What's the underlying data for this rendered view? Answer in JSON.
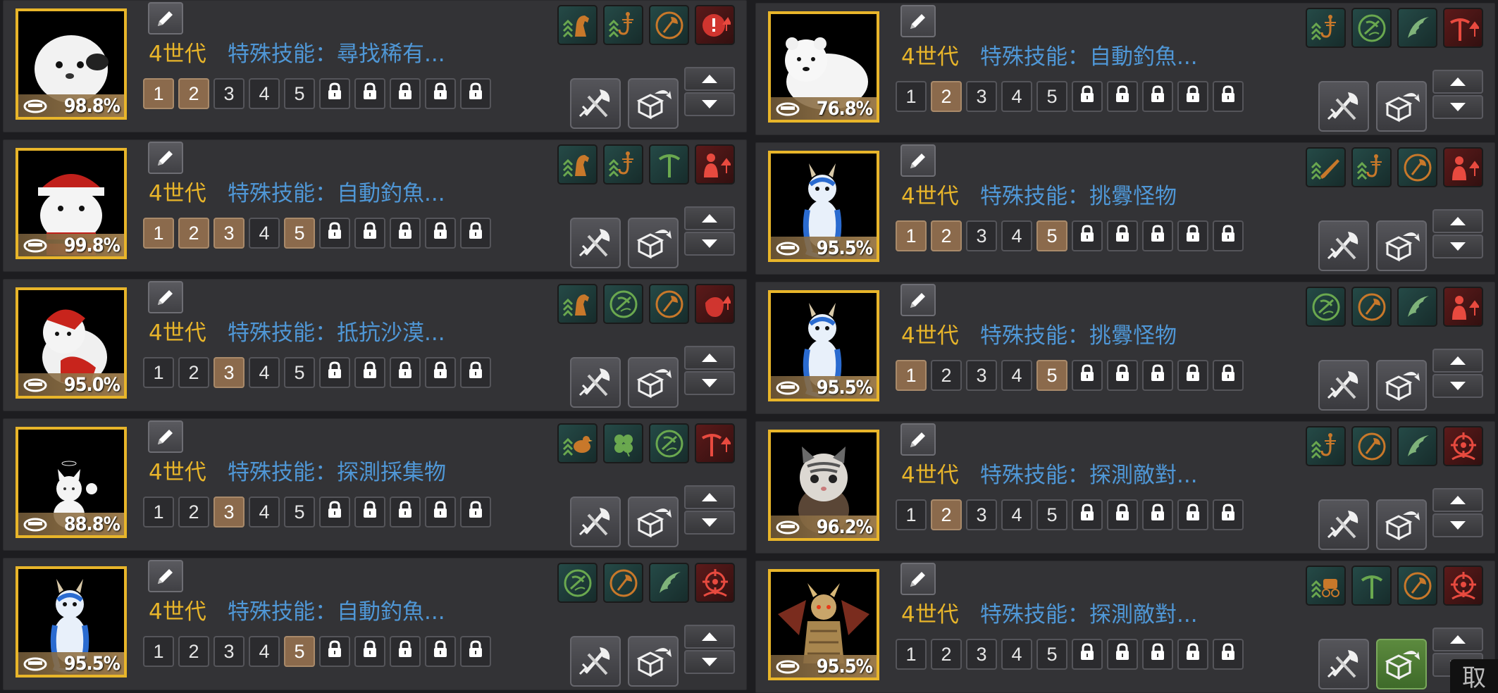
{
  "colors": {
    "gold": "#e8b52a",
    "skill_text": "#4f97d6",
    "active_slot": "#8b6a4c",
    "panel": "#333336"
  },
  "pets": [
    {
      "stamina": "98.8%",
      "generation": "4世代",
      "skill": "特殊技能：尋找稀有...",
      "active_slots": [
        1,
        2
      ],
      "abilities": [
        "horse-rank-icon",
        "fishing-rank-icon",
        "axe-icon",
        "red-alert-icon"
      ],
      "art": "seal"
    },
    {
      "stamina": "99.8%",
      "generation": "4世代",
      "skill": "特殊技能：自動釣魚...",
      "active_slots": [
        1,
        2,
        3,
        5
      ],
      "abilities": [
        "horse-rank-icon",
        "fishing-rank-icon",
        "pickaxe-icon",
        "red-person-up-icon"
      ],
      "art": "santa"
    },
    {
      "stamina": "95.0%",
      "generation": "4世代",
      "skill": "特殊技能：抵抗沙漠...",
      "active_slots": [
        3
      ],
      "abilities": [
        "horse-rank-icon",
        "gather-icon",
        "axe-icon",
        "red-bag-icon"
      ],
      "art": "redcat"
    },
    {
      "stamina": "88.8%",
      "generation": "4世代",
      "skill": "特殊技能：探測採集物",
      "active_slots": [
        3
      ],
      "abilities": [
        "bird-icon",
        "clover-icon",
        "gather-icon",
        "red-pickaxe-up-icon"
      ],
      "art": "whitecat"
    },
    {
      "stamina": "95.5%",
      "generation": "4世代",
      "skill": "特殊技能：自動釣魚...",
      "active_slots": [
        5
      ],
      "abilities": [
        "gather-icon",
        "axe-icon",
        "wing-icon",
        "red-target-icon"
      ],
      "art": "dragon"
    },
    {
      "stamina": "76.8%",
      "generation": "4世代",
      "skill": "特殊技能：自動釣魚...",
      "active_slots": [
        2
      ],
      "abilities": [
        "fishing-rank-icon",
        "gather-icon",
        "wing-icon",
        "red-pickaxe-up-icon"
      ],
      "art": "bear"
    },
    {
      "stamina": "95.5%",
      "generation": "4世代",
      "skill": "特殊技能：挑釁怪物",
      "active_slots": [
        1,
        2,
        5
      ],
      "abilities": [
        "gun-rank-icon",
        "fishing-rank-icon",
        "axe-icon",
        "red-person-up-icon"
      ],
      "art": "dragon"
    },
    {
      "stamina": "95.5%",
      "generation": "4世代",
      "skill": "特殊技能：挑釁怪物",
      "active_slots": [
        1,
        5
      ],
      "abilities": [
        "gather-icon",
        "axe-icon",
        "wing-icon",
        "red-person-up-icon"
      ],
      "art": "dragon"
    },
    {
      "stamina": "96.2%",
      "generation": "4世代",
      "skill": "特殊技能：探測敵對...",
      "active_slots": [
        2
      ],
      "abilities": [
        "fishing-rank-icon",
        "axe-icon",
        "wing-icon",
        "red-target-icon"
      ],
      "art": "tabby"
    },
    {
      "stamina": "95.5%",
      "generation": "4世代",
      "skill": "特殊技能：探測敵對...",
      "active_slots": [],
      "abilities": [
        "carriage-rank-icon",
        "pickaxe-icon",
        "axe-icon",
        "red-target-icon"
      ],
      "art": "golddragon"
    }
  ],
  "slot_numbers": [
    "1",
    "2",
    "3",
    "4",
    "5"
  ],
  "locked_slots": 5,
  "corner_label": "取"
}
